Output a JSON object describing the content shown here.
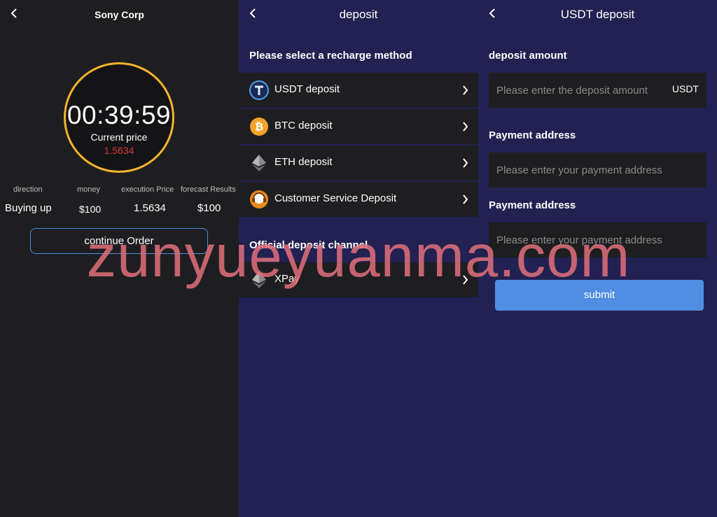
{
  "order": {
    "title": "Sony Corp",
    "timer": "00:39:59",
    "current_price_label": "Current price",
    "current_price": "1.5634",
    "headers": [
      "direction",
      "money",
      "execution Price",
      "forecast Results"
    ],
    "direction": "Buying up",
    "money": "$100",
    "execution_price": "1.5634",
    "forecast_results": "$100",
    "continue_label": "continue Order"
  },
  "deposit": {
    "title": "deposit",
    "section_methods": "Please select a recharge method",
    "methods": [
      {
        "label": "USDT deposit",
        "icon": "tether-icon"
      },
      {
        "label": "BTC deposit",
        "icon": "bitcoin-icon"
      },
      {
        "label": "ETH deposit",
        "icon": "ethereum-icon"
      },
      {
        "label": "Customer Service Deposit",
        "icon": "customer-service-icon"
      }
    ],
    "section_official": "Official deposit channel",
    "official": [
      {
        "label": "XPay",
        "icon": "ethereum-icon"
      }
    ]
  },
  "usdt": {
    "title": "USDT deposit",
    "amount_label": "deposit amount",
    "amount_placeholder": "Please enter the deposit amount",
    "amount_unit": "USDT",
    "address_label_1": "Payment address",
    "address_placeholder_1": "Please enter your payment address",
    "address_label_2": "Payment address",
    "address_placeholder_2": "Please enter your payment address",
    "submit_label": "submit"
  },
  "watermark": "zunyueyuanma.com",
  "colors": {
    "accent": "#4f8ee2",
    "timer_ring": "#f4b42a",
    "price_red": "#d33a3a",
    "panel_navy": "#222151"
  }
}
